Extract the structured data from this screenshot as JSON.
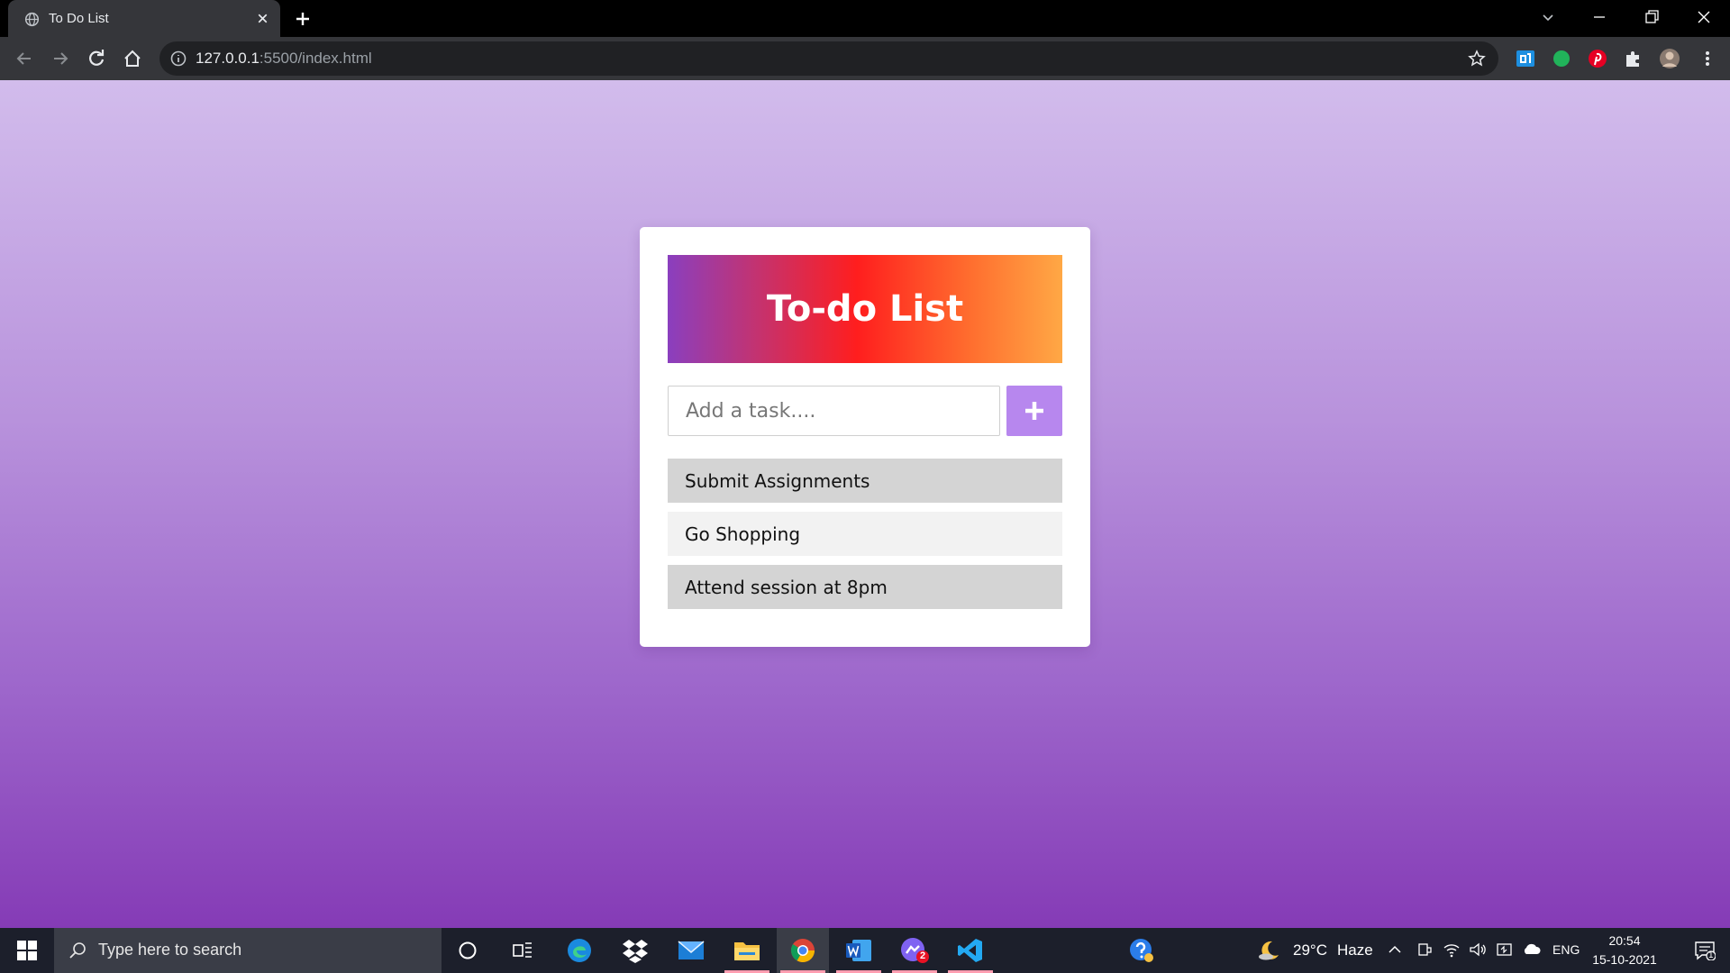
{
  "browser": {
    "tab_title": "To Do List",
    "url_host": "127.0.0.1",
    "url_rest": ":5500/index.html"
  },
  "app": {
    "title": "To-do List",
    "input_placeholder": "Add a task....",
    "add_button_symbol": "+",
    "tasks": [
      {
        "text": "Submit Assignments"
      },
      {
        "text": "Go Shopping"
      },
      {
        "text": "Attend session at 8pm"
      }
    ]
  },
  "taskbar": {
    "search_placeholder": "Type here to search",
    "weather_temp": "29°C",
    "weather_desc": "Haze",
    "language": "ENG",
    "time": "20:54",
    "date": "15-10-2021",
    "notification_count": "1",
    "messenger_badge": "2"
  },
  "colors": {
    "header_gradient": [
      "#8a3fbf",
      "#ff1e1e",
      "#ffa845"
    ],
    "add_button": "#b787ee",
    "page_gradient": [
      "#d2bcec",
      "#853bb6"
    ]
  }
}
